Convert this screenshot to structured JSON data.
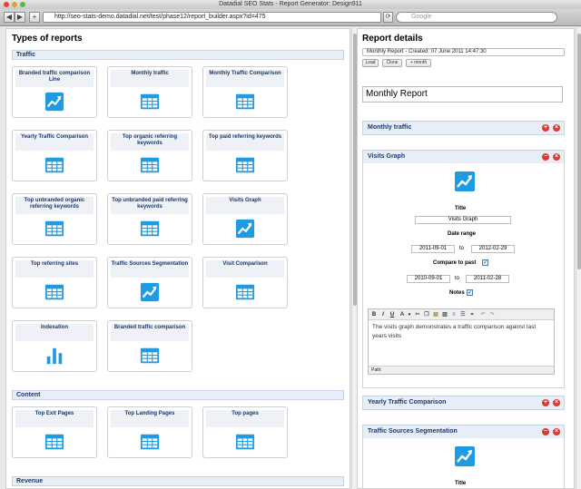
{
  "browser": {
    "title": "Datadial SEO Stats - Report Generator: Design911",
    "url": "http://seo-stats-demo.datadial.net/test/phase12/report_builder.aspx?id=475",
    "search_placeholder": "Google"
  },
  "left": {
    "heading": "Types of reports",
    "sections": {
      "traffic": "Traffic",
      "content": "Content",
      "revenue": "Revenue"
    },
    "traffic_cards": [
      {
        "title": "Branded traffic comparison Line",
        "icon": "line-chart-icon"
      },
      {
        "title": "Monthly traffic",
        "icon": "table-icon"
      },
      {
        "title": "Monthly Traffic Comparison",
        "icon": "table-icon"
      },
      {
        "title": "Yearly Traffic Comparison",
        "icon": "table-icon"
      },
      {
        "title": "Top organic referring keywords",
        "icon": "table-icon"
      },
      {
        "title": "Top paid referring keywords",
        "icon": "table-icon"
      },
      {
        "title": "Top unbranded organic referring keywords",
        "icon": "table-icon"
      },
      {
        "title": "Top unbranded paid referring keywords",
        "icon": "table-icon"
      },
      {
        "title": "Visits Graph",
        "icon": "line-chart-icon"
      },
      {
        "title": "Top referring sites",
        "icon": "table-icon"
      },
      {
        "title": "Traffic Sources Segmentation",
        "icon": "line-chart-icon"
      },
      {
        "title": "Visit Comparison",
        "icon": "table-icon"
      },
      {
        "title": "Indexation",
        "icon": "bar-chart-icon"
      },
      {
        "title": "Branded traffic comparison",
        "icon": "table-icon"
      }
    ],
    "content_cards": [
      {
        "title": "Top Exit Pages",
        "icon": "table-icon"
      },
      {
        "title": "Top Landing Pages",
        "icon": "table-icon"
      },
      {
        "title": "Top pages",
        "icon": "table-icon"
      }
    ]
  },
  "right": {
    "heading": "Report details",
    "select_value": "Monthly Report - Created: 07 June 2011 14:47:30",
    "buttons": {
      "load": "Load",
      "clone": "Clone",
      "month": "+ month"
    },
    "report_name": "Monthly Report",
    "widgets": {
      "monthly_traffic": "Monthly traffic",
      "visits_graph": "Visits Graph",
      "yearly": "Yearly Traffic Comparison",
      "traffic_sources": "Traffic Sources Segmentation"
    },
    "visits_form": {
      "title_label": "Title",
      "title_value": "Visits Graph",
      "date_range_label": "Date range",
      "date_from": "2011-09-01",
      "to1": "to",
      "date_to": "2012-02-29",
      "compare_label": "Compare to past",
      "past_from": "2010-09-01",
      "to2": "to",
      "past_to": "2011-02-28",
      "notes_label": "Notes",
      "check": "✓",
      "notes_text": "The visits graph demonstrates a traffic comparison against last years visits",
      "path_label": "Path:"
    },
    "traffic_sources_form": {
      "title_label": "Title"
    }
  },
  "colors": {
    "accent": "#1e9be3",
    "section_bg": "#e8eef7",
    "danger": "#d93a2e"
  }
}
